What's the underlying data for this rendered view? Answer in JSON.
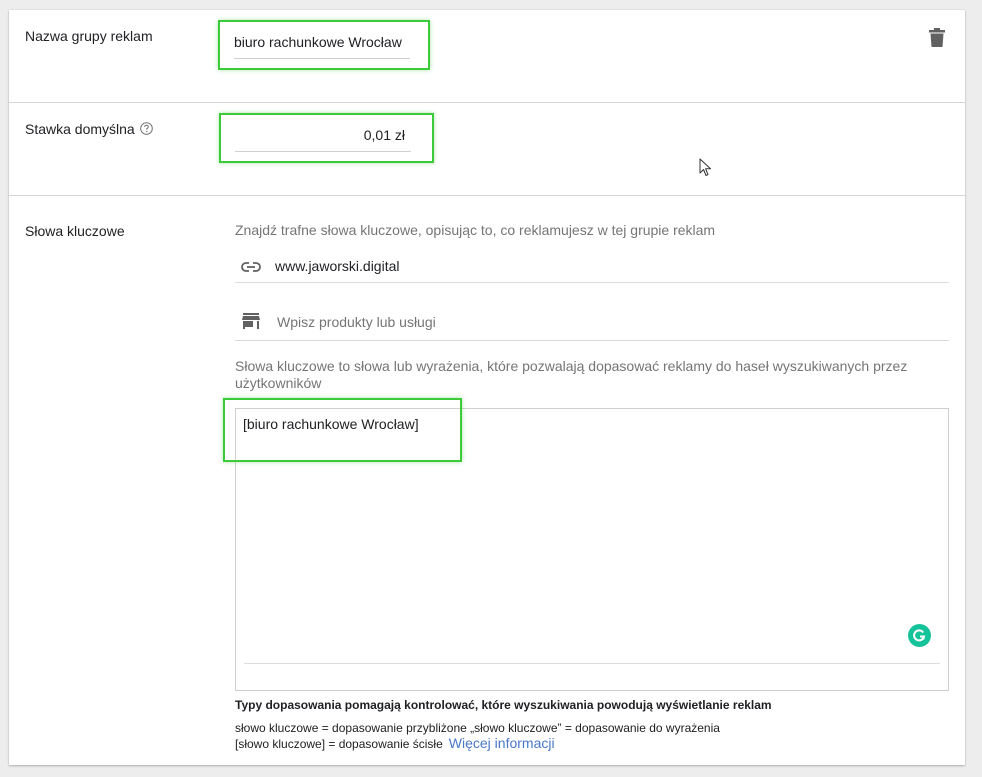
{
  "ad_group": {
    "name_label": "Nazwa grupy reklam",
    "name_value": "biuro rachunkowe Wrocław"
  },
  "bid": {
    "label": "Stawka domyślna",
    "value": "0,01 zł"
  },
  "keywords": {
    "label": "Słowa kluczowe",
    "hint": "Znajdź trafne słowa kluczowe, opisując to, co reklamujesz w tej grupie reklam",
    "website": "www.jaworski.digital",
    "products_placeholder": "Wpisz produkty lub usługi",
    "description": "Słowa kluczowe to słowa lub wyrażenia, które pozwalają dopasować reklamy do haseł wyszukiwanych przez użytkowników",
    "textarea_value": "[biuro rachunkowe Wrocław]",
    "match_types_title": "Typy dopasowania pomagają kontrolować, które wyszukiwania powodują wyświetlanie reklam",
    "match_line_1": "słowo kluczowe = dopasowanie przybliżone   „słowo kluczowe” = dopasowanie do wyrażenia",
    "match_line_2": "[słowo kluczowe] = dopasowanie ścisłe",
    "more_info_link": "Więcej informacji"
  },
  "icons": {
    "delete": "trash-icon",
    "help": "help-circle-icon",
    "link": "link-icon",
    "store": "store-icon",
    "grammarly": "grammarly-icon"
  },
  "colors": {
    "highlight": "#3cc93a",
    "link": "#4a78c9",
    "grammarly": "#15c39a"
  }
}
